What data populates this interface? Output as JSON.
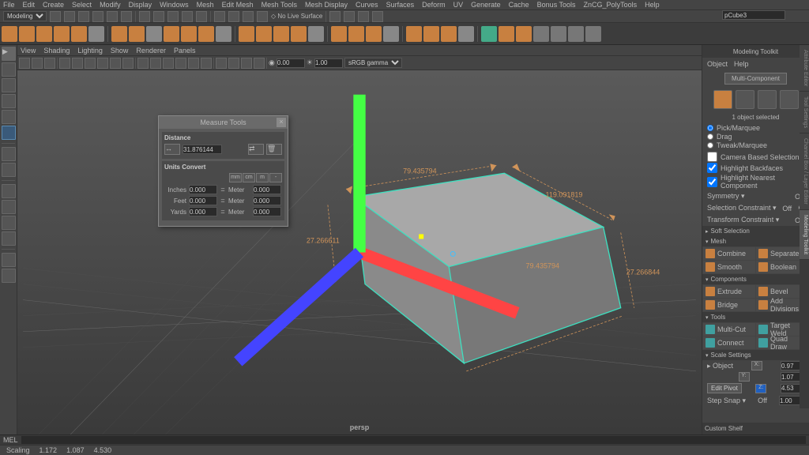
{
  "menubar": [
    "File",
    "Edit",
    "Create",
    "Select",
    "Modify",
    "Display",
    "Windows",
    "Mesh",
    "Edit Mesh",
    "Mesh Tools",
    "Mesh Display",
    "Curves",
    "Surfaces",
    "Deform",
    "UV",
    "Generate",
    "Cache",
    "Bonus Tools",
    "ZnCG_PolyTools",
    "Help"
  ],
  "workspace_dropdown": "Modeling",
  "object_name": "pCube3",
  "panel_menu": [
    "View",
    "Shading",
    "Lighting",
    "Show",
    "Renderer",
    "Panels"
  ],
  "panel_toolbar": {
    "fov": "0.00",
    "exposure": "1.00",
    "gamma": "sRGB gamma"
  },
  "viewport": {
    "persp": "persp",
    "dims": {
      "width": "79.435794",
      "depth": "119.091819",
      "height_left": "27.266611",
      "height_right": "27.266844",
      "base": "79.435794"
    }
  },
  "measure": {
    "title": "Measure Tools",
    "distance_label": "Distance",
    "distance": "31.876144",
    "convert_label": "Units Convert",
    "tabs": [
      "mm",
      "cm",
      "m",
      "-"
    ],
    "rows": [
      {
        "from": "Inches",
        "fv": "0.000",
        "to": "Meter",
        "tv": "0.000"
      },
      {
        "from": "Feet",
        "fv": "0.000",
        "to": "Meter",
        "tv": "0.000"
      },
      {
        "from": "Yards",
        "fv": "0.000",
        "to": "Meter",
        "tv": "0.000"
      }
    ]
  },
  "right": {
    "title": "Modeling Toolkit",
    "tabs": [
      "Object",
      "Help"
    ],
    "multi_component": "Multi-Component",
    "selected": "1 object selected",
    "pick_modes": [
      "Pick/Marquee",
      "Drag",
      "Tweak/Marquee"
    ],
    "camera_based": "Camera Based Selection",
    "hl_backfaces": "Highlight Backfaces",
    "hl_nearest": "Highlight Nearest Component",
    "symmetry": {
      "label": "Symmetry ▾",
      "value": "Off"
    },
    "sel_constraint": {
      "label": "Selection Constraint ▾",
      "value": "Off"
    },
    "xform_constraint": {
      "label": "Transform Constraint ▾",
      "value": "Off"
    },
    "soft_sel": "Soft Selection",
    "mesh_hdr": "Mesh",
    "mesh_tools": [
      "Combine",
      "Separate",
      "Smooth",
      "Boolean"
    ],
    "comp_hdr": "Components",
    "comp_tools": [
      "Extrude",
      "Bevel",
      "Bridge",
      "Add Divisions"
    ],
    "tools_hdr": "Tools",
    "tools": [
      "Multi-Cut",
      "Target Weld",
      "Connect",
      "Quad Draw"
    ],
    "scale_hdr": "Scale Settings",
    "scale_mode": "Object",
    "scale": {
      "x": "0.97",
      "y": "1.07",
      "z": "4.53"
    },
    "edit_pivot": "Edit Pivot",
    "step_snap": {
      "label": "Step Snap ▾",
      "value": "Off",
      "amount": "1.00"
    },
    "custom_shelf": "Custom Shelf"
  },
  "shelf_colors": [
    "#c88040",
    "#c88040",
    "#c88040",
    "#c88040",
    "#c88040",
    "#888",
    "#c88040",
    "#c88040",
    "#888",
    "#c88040",
    "#c88040",
    "#c88040",
    "#888",
    "#c88040",
    "#c88040",
    "#c88040",
    "#c88040",
    "#888",
    "#c88040",
    "#c88040",
    "#c88040",
    "#888",
    "#c88040",
    "#c88040",
    "#c88040",
    "#888",
    "#4a8",
    "#c88040",
    "#c88040",
    "#777",
    "#777",
    "#777",
    "#777"
  ],
  "status": {
    "mode": "Scaling",
    "x": "1.172",
    "y": "1.087",
    "z": "4.530"
  },
  "cmd": "MEL"
}
